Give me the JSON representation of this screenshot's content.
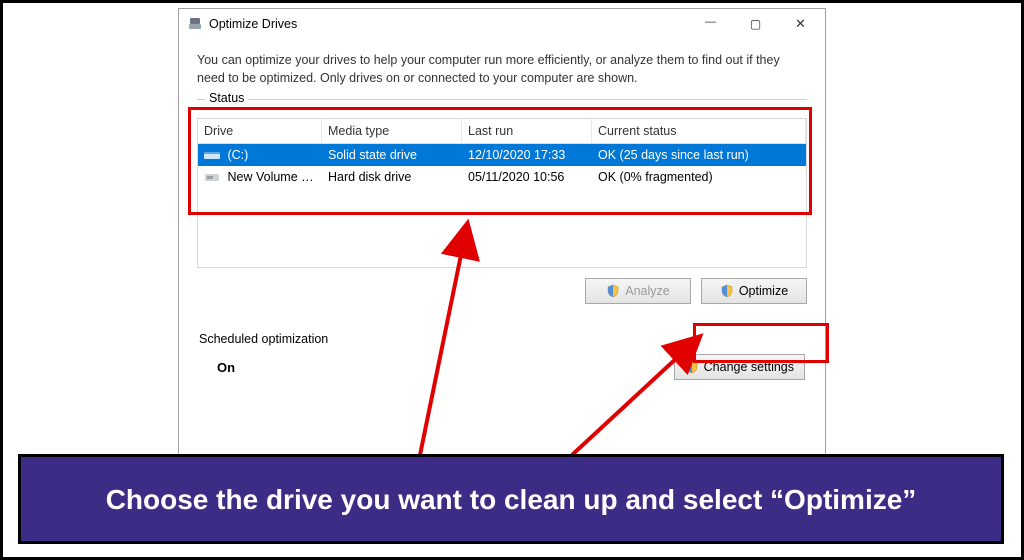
{
  "window": {
    "title": "Optimize Drives",
    "description": "You can optimize your drives to help your computer run more efficiently, or analyze them to find out if they need to be optimized. Only drives on or connected to your computer are shown."
  },
  "status": {
    "legend": "Status",
    "columns": {
      "drive": "Drive",
      "media": "Media type",
      "last": "Last run",
      "current": "Current status"
    },
    "rows": [
      {
        "drive": "(C:)",
        "media": "Solid state drive",
        "last": "12/10/2020 17:33",
        "current": "OK (25 days since last run)",
        "selected": true
      },
      {
        "drive": "New Volume (D:)",
        "media": "Hard disk drive",
        "last": "05/11/2020 10:56",
        "current": "OK (0% fragmented)",
        "selected": false
      }
    ]
  },
  "buttons": {
    "analyze": "Analyze",
    "optimize": "Optimize",
    "change": "Change settings"
  },
  "schedule": {
    "label": "Scheduled optimization",
    "state": "On"
  },
  "banner": "Choose the drive you want to clean up and select “Optimize”"
}
